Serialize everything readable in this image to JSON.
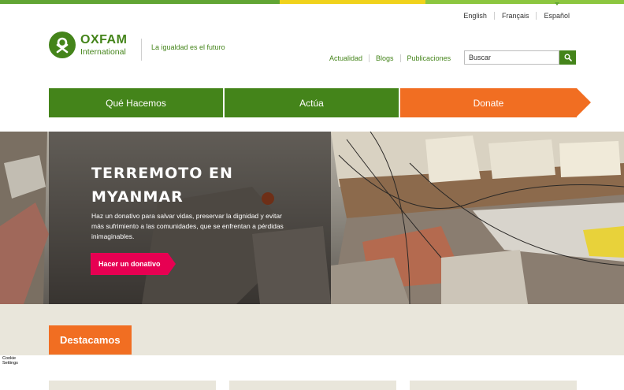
{
  "colors": {
    "brand_green": "#44841a",
    "donate_orange": "#f16e22",
    "cta_pink": "#e70052",
    "stripe": [
      "#61a534",
      "#f0d21b",
      "#8cc63f"
    ]
  },
  "languages": [
    {
      "label": "English",
      "active": false
    },
    {
      "label": "Français",
      "active": false
    },
    {
      "label": "Español",
      "active": true
    }
  ],
  "logo": {
    "line1": "OXFAM",
    "line2": "International",
    "icon": "oxfam-logo-icon"
  },
  "tagline": "La igualdad es el futuro",
  "top_nav": [
    "Actualidad",
    "Blogs",
    "Publicaciones"
  ],
  "search": {
    "placeholder": "Buscar",
    "icon": "search-icon"
  },
  "main_nav": [
    "Qué Hacemos",
    "Actúa",
    "Donate"
  ],
  "hero": {
    "title": "TERREMOTO EN MYANMAR",
    "body": "Haz un donativo para salvar vidas, preservar la dignidad y evitar más sufrimiento a las comunidades, que se enfrentan a pérdidas inimaginables.",
    "cta": "Hacer un donativo"
  },
  "featured": {
    "heading": "Destacamos"
  },
  "cookie": {
    "line1": "Cookie",
    "line2": "Settings"
  }
}
